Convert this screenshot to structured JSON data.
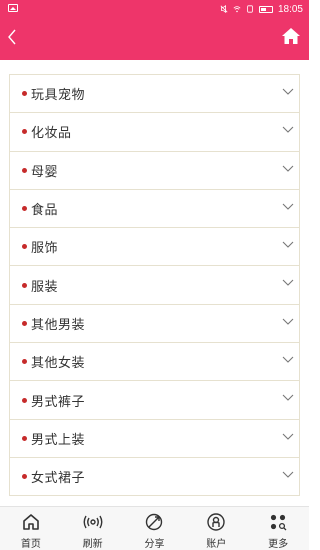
{
  "status_bar": {
    "time": "18:05"
  },
  "header": {
    "back_icon": "chevron-left-icon",
    "home_icon": "home-icon",
    "color": "#ee356a"
  },
  "categories": [
    {
      "label": "玩具宠物"
    },
    {
      "label": "化妆品"
    },
    {
      "label": "母婴"
    },
    {
      "label": "食品"
    },
    {
      "label": "服饰"
    },
    {
      "label": "服装"
    },
    {
      "label": "其他男装"
    },
    {
      "label": "其他女装"
    },
    {
      "label": "男式裤子"
    },
    {
      "label": "男式上装"
    },
    {
      "label": "女式裙子"
    }
  ],
  "tabbar": {
    "items": [
      {
        "label": "首页",
        "icon": "home-icon"
      },
      {
        "label": "刷新",
        "icon": "refresh-icon"
      },
      {
        "label": "分享",
        "icon": "share-icon"
      },
      {
        "label": "账户",
        "icon": "account-icon"
      },
      {
        "label": "更多",
        "icon": "more-icon"
      }
    ]
  }
}
